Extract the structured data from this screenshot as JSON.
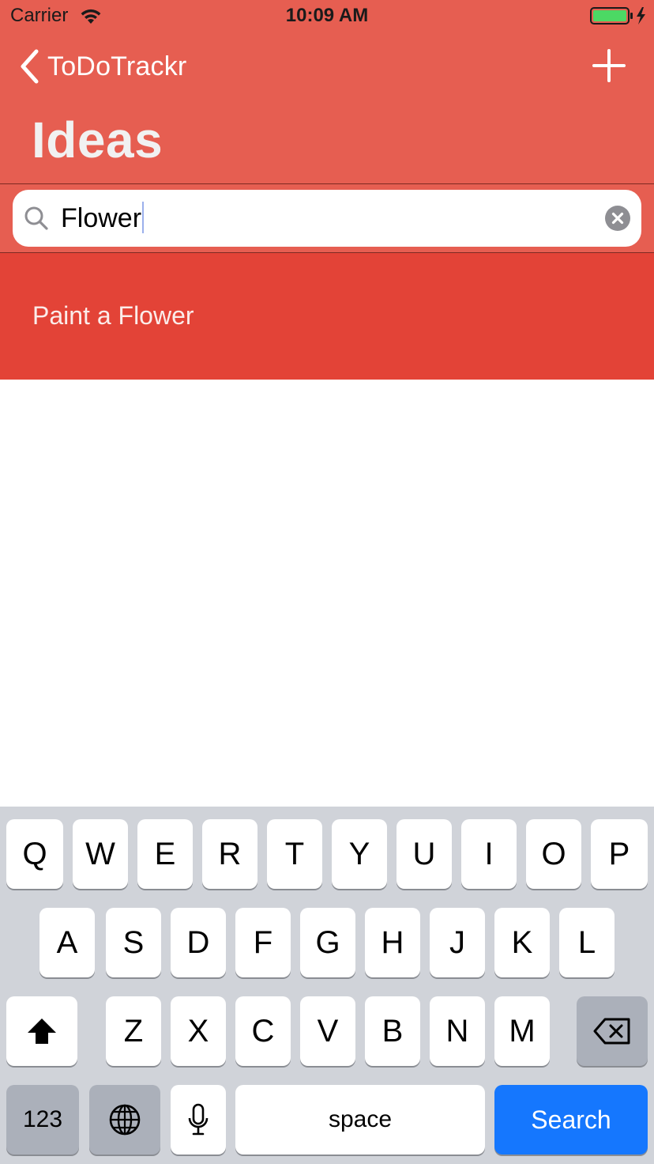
{
  "status_bar": {
    "carrier": "Carrier",
    "time": "10:09 AM",
    "wifi_icon": "wifi-icon",
    "battery_icon": "battery-charging-icon",
    "battery_color": "#4CD964"
  },
  "nav": {
    "back_label": "ToDoTrackr",
    "back_icon": "chevron-left-icon",
    "add_icon": "plus-icon",
    "title": "Ideas"
  },
  "search": {
    "value": "Flower",
    "search_icon": "magnifier-icon",
    "clear_icon": "clear-circle-icon"
  },
  "results": [
    {
      "label": "Paint a Flower"
    }
  ],
  "keyboard": {
    "row1": [
      "Q",
      "W",
      "E",
      "R",
      "T",
      "Y",
      "U",
      "I",
      "O",
      "P"
    ],
    "row2": [
      "A",
      "S",
      "D",
      "F",
      "G",
      "H",
      "J",
      "K",
      "L"
    ],
    "row3": [
      "Z",
      "X",
      "C",
      "V",
      "B",
      "N",
      "M"
    ],
    "numbers_label": "123",
    "space_label": "space",
    "search_label": "Search",
    "shift_icon": "shift-arrow-icon",
    "delete_icon": "backspace-icon",
    "globe_icon": "globe-icon",
    "mic_icon": "microphone-icon"
  },
  "colors": {
    "header": "#E65E51",
    "result_row": "#E34337",
    "keyboard_bg": "#D0D3D9",
    "search_key": "#1577FE"
  }
}
